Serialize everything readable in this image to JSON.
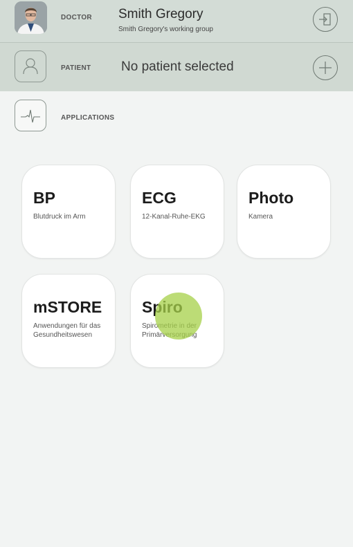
{
  "doctor": {
    "label": "DOCTOR",
    "name": "Smith Gregory",
    "group": "Smith Gregory's working group",
    "logout_icon": "logout-icon"
  },
  "patient": {
    "label": "PATIENT",
    "status": "No patient selected",
    "icon": "person-icon",
    "add_icon": "plus-icon"
  },
  "applications": {
    "label": "APPLICATIONS",
    "icon": "heartbeat-icon",
    "tiles": [
      {
        "title": "BP",
        "subtitle": "Blutdruck im Arm"
      },
      {
        "title": "ECG",
        "subtitle": "12-Kanal-Ruhe-EKG"
      },
      {
        "title": "Photo",
        "subtitle": "Kamera"
      },
      {
        "title": "mSTORE",
        "subtitle": "Anwendungen für das Gesundheitswesen"
      },
      {
        "title": "Spiro",
        "subtitle": "Spirometrie in der Primärversorgung"
      }
    ]
  },
  "colors": {
    "header_bg": "#d3dcd6",
    "page_bg": "#f2f4f3",
    "touch_indicator": "#a6d048"
  }
}
